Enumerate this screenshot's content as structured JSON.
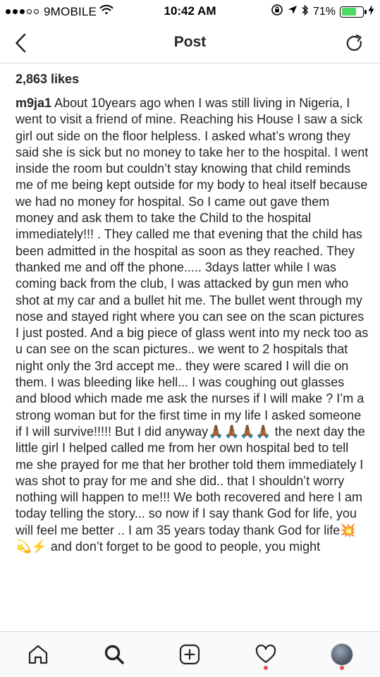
{
  "status_bar": {
    "carrier": "9MOBILE",
    "time": "10:42 AM",
    "battery": "71%",
    "battery_level": 0.71
  },
  "nav": {
    "title": "Post",
    "back_icon": "chevron-left-icon",
    "refresh_icon": "refresh-icon"
  },
  "post": {
    "likes": "2,863 likes",
    "username": "m9ja1",
    "caption": "About 10years ago when I was still living in Nigeria, I went to visit a friend of mine. Reaching his House I saw a sick girl out side on the floor helpless. I asked what’s wrong they said she is sick but no money to take her to the hospital. I went inside the room but couldn’t stay knowing that child reminds me of me being kept outside for my body to heal itself because we had no money for hospital. So I came out gave them money and ask them to take the Child to the hospital immediately!!! . They called me that evening that the child has been admitted in the hospital as soon as they reached. They thanked me and off the phone..... 3days latter while I was coming back from the club, I was attacked by gun men who shot at my car and a bullet hit me. The bullet went through my nose and stayed right where you can see on the scan pictures I just posted. And a big piece of glass went into my neck too as u can see on the scan pictures.. we went to 2 hospitals that night only the 3rd accept me.. they were scared I will die on them. I was bleeding like hell... I was coughing out glasses and blood which made me ask the nurses if I will make ? I’m a strong woman but for the first time in my life I asked someone if I will survive!!!!! But I did anyway🙏🏾🙏🏾🙏🏾🙏🏾 the next day the little girl I helped called me from her own hospital bed to tell me she prayed for me that her brother told them immediately I was shot to pray for me and she did.. that I shouldn’t worry nothing will happen to me!!! We both recovered and here I am today telling the story... so now if I say thank God for life, you will feel me better .. I am 35 years today thank God for life💥💫⚡️ and don’t forget to be good to people, you might"
  },
  "tab_bar": {
    "items": [
      "home-icon",
      "search-icon",
      "add-post-icon",
      "heart-icon",
      "profile-avatar"
    ],
    "accent_notification": "#ed4956"
  }
}
